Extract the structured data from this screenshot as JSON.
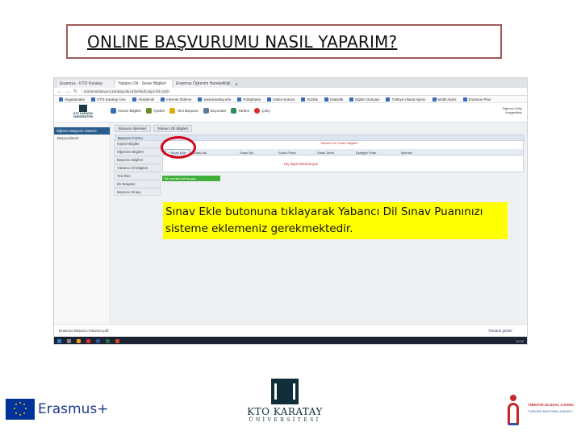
{
  "slide": {
    "title": "ONLINE BAŞVURUMU NASIL YAPARIM?",
    "callout": "Sınav Ekle butonuna tıklayarak Yabancı Dil Sınav Puanınızı sisteme eklemeniz gerekmektedir."
  },
  "browser": {
    "tabs": [
      {
        "label": "Erasmus - KTO Karatay"
      },
      {
        "label": "Yabancı Dil - Sınav Bilgileri"
      },
      {
        "label": "Erasmus Öğrenim Hareketliliği"
      }
    ],
    "url": "erasmusbasvuru.karatay.edu.tr/Default.aspx?id=1024",
    "bookmarks": [
      "Uygulamalar",
      "KTO Karatay Ünv.",
      "Akademik",
      "Internet Ödeme",
      "www.karatay.edu",
      "Kütüphane",
      "Gelen Kutusu",
      "Sözlük",
      "İstatistik",
      "Eğitim Dünyası",
      "Türkiye Ulusal Ajansı",
      "Mobil Ajans",
      "Erasmus Plus"
    ]
  },
  "app": {
    "logo_text": "KTO KARATAY ÜNİVERSİTESİ",
    "toolbar": [
      "Kurum Bilgileri",
      "Ayarlar",
      "Yeni Başvuru",
      "Duyurular",
      "Yardım",
      "Çıkış"
    ],
    "user": [
      "Öğrenci Girişi",
      "Hoşgeldiniz"
    ],
    "sidebar_title": "Öğrenci Başvuru Sistemi",
    "sidebar_items": [
      "Başvurularım"
    ],
    "crumbs": [
      "Başvuru İşlemleri",
      "Yabancı Dil Bilgileri"
    ],
    "panel_title": "Başvuru Formu",
    "menu": [
      "Kişisel Bilgiler",
      "Öğrenim Bilgileri",
      "Başvuru Bilgileri",
      "Yabancı Dil Bilgileri",
      "Tercihler",
      "Ek Belgeler",
      "Başvuru Onayı"
    ],
    "grid_caption": "Yabancı Dil Sınavı Bilgileri",
    "add_button": "Sınav Ekle",
    "grid_headers": [
      "Sınav Adı",
      "Sınav Dili",
      "Sınav Puanı",
      "Sınav Tarihi",
      "Eşdeğer Puan",
      "İşlemler"
    ],
    "no_data": "Hiç kayıt bulunmuyor.",
    "next_button": "Bir sonraki adıma geç"
  },
  "status": {
    "download": "Erasmus Başvuru Kılavuzu.pdf",
    "show_all": "Tümünü göster"
  },
  "taskbar": {
    "clock": "14:52"
  },
  "footer": {
    "erasmus": "Erasmus+",
    "karatay_line1": "KTO KARATAY",
    "karatay_line2": "ÜNİVERSİTESİ",
    "tuba_line1": "TÜRKİYE ULUSAL AJANSI",
    "tuba_line2": "TURKISH NATIONAL AGENCY"
  },
  "colors": {
    "highlight": "#ffff00",
    "circle": "#d4001a",
    "title_border": "#a05a5a"
  }
}
